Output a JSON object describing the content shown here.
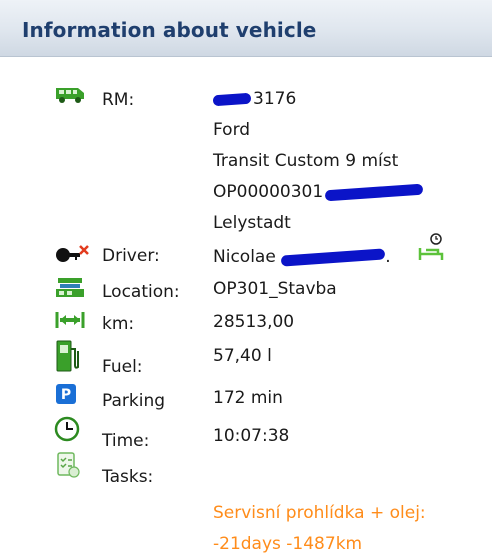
{
  "header": {
    "title": "Information about vehicle"
  },
  "vehicle": {
    "rm_label": "RM:",
    "rm_lines": [
      "3176",
      "Ford",
      "Transit Custom 9 míst",
      "OP00000301",
      "Lelystadt"
    ],
    "driver_label": "Driver:",
    "driver_value": "Nicolae",
    "driver_suffix": ".",
    "location_label": "Location:",
    "location_value": "OP301_Stavba",
    "km_label": "km:",
    "km_value": "28513,00",
    "fuel_label": "Fuel:",
    "fuel_value": "57,40 l",
    "parking_label": "Parking",
    "parking_value": "172 min",
    "time_label": "Time:",
    "time_value": "10:07:38",
    "tasks_label": "Tasks:",
    "task_warning": "Servisní prohlídka + olej: -21days -1487km"
  },
  "colors": {
    "header_text": "#1f3f6e",
    "icon_green": "#3aa02a",
    "parking_blue": "#1a6fd6",
    "redaction_blue": "#0b14c8",
    "warning_orange": "#ff8c1a"
  },
  "icons": [
    "van-icon",
    "driver-key-icon",
    "location-building-icon",
    "distance-icon",
    "fuel-pump-icon",
    "parking-icon",
    "clock-icon",
    "tasks-icon",
    "driver-rest-icon"
  ]
}
